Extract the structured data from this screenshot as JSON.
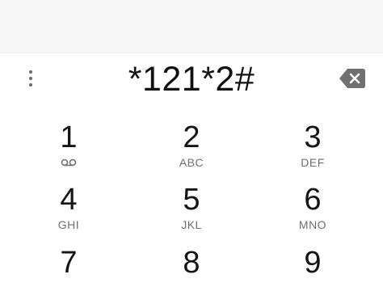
{
  "dialer": {
    "input_value": "*121*2#",
    "icons": {
      "overflow": "more-vert-icon",
      "backspace": "backspace-icon",
      "voicemail": "voicemail-icon"
    },
    "colors": {
      "background": "#ffffff",
      "top_band": "#f7f7f7",
      "digit_text": "#111111",
      "letters_text": "#6f6f6f",
      "backspace_fill": "#707070"
    }
  },
  "keypad": {
    "keys": [
      {
        "digit": "1",
        "letters": ""
      },
      {
        "digit": "2",
        "letters": "ABC"
      },
      {
        "digit": "3",
        "letters": "DEF"
      },
      {
        "digit": "4",
        "letters": "GHI"
      },
      {
        "digit": "5",
        "letters": "JKL"
      },
      {
        "digit": "6",
        "letters": "MNO"
      },
      {
        "digit": "7",
        "letters": ""
      },
      {
        "digit": "8",
        "letters": ""
      },
      {
        "digit": "9",
        "letters": ""
      }
    ]
  }
}
